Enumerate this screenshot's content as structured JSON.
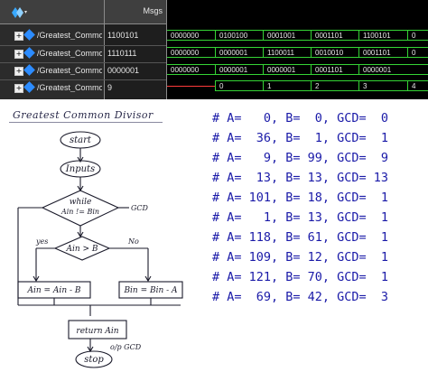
{
  "wave_viewer": {
    "header": {
      "msgs_label": "Msgs",
      "logo_icon": "modelsim-logo-icon"
    },
    "signals": [
      {
        "name": "/Greatest_Common...",
        "value": "1100101"
      },
      {
        "name": "/Greatest_Common...",
        "value": "1110111"
      },
      {
        "name": "/Greatest_Common...",
        "value": "0000001"
      },
      {
        "name": "/Greatest_Common...",
        "value": "9"
      }
    ],
    "waves": [
      [
        "0000000",
        "0100100",
        "0001001",
        "0001101",
        "1100101",
        "0"
      ],
      [
        "0000000",
        "0000001",
        "1100011",
        "0010010",
        "0001101",
        "0"
      ],
      [
        "0000000",
        "0000001",
        "0000001",
        "0001101",
        "0000001",
        ""
      ],
      [
        "",
        "0",
        "1",
        "2",
        "3",
        "4"
      ]
    ],
    "colors": {
      "wave": "#35d435",
      "undefined": "#ff3b3b",
      "background": "#000000"
    }
  },
  "flowchart": {
    "title": "Greatest Common Divisor",
    "start": "start",
    "inputs": "Inputs",
    "while_line1": "while",
    "while_line2": "Ain != Bin",
    "gcd_label": "GCD",
    "condition": "Ain > B",
    "yes_label": "yes",
    "no_label": "No",
    "left_box": "Ain = Ain - B",
    "right_box": "Bin = Bin - A",
    "return_box": "return Ain",
    "output_label": "o/p GCD",
    "stop": "stop"
  },
  "console": {
    "lines": [
      "# A=   0, B=  0, GCD=  0",
      "# A=  36, B=  1, GCD=  1",
      "# A=   9, B= 99, GCD=  9",
      "# A=  13, B= 13, GCD= 13",
      "# A= 101, B= 18, GCD=  1",
      "# A=   1, B= 13, GCD=  1",
      "# A= 118, B= 61, GCD=  1",
      "# A= 109, B= 12, GCD=  1",
      "# A= 121, B= 70, GCD=  1",
      "# A=  69, B= 42, GCD=  3"
    ],
    "text_color": "#1a1aa8"
  }
}
